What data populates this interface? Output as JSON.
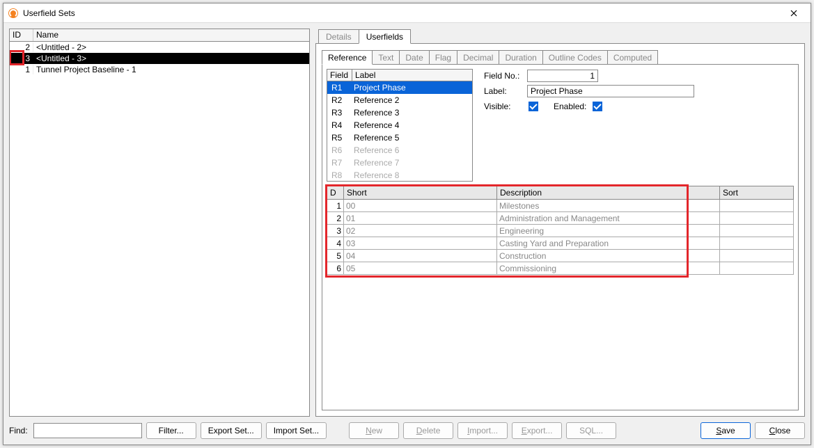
{
  "window": {
    "title": "Userfield Sets"
  },
  "sets": {
    "columns": {
      "id": "ID",
      "name": "Name"
    },
    "rows": [
      {
        "id": "2",
        "name": "<Untitled - 2>",
        "selected": false
      },
      {
        "id": "3",
        "name": "<Untitled - 3>",
        "selected": true
      },
      {
        "id": "1",
        "name": "Tunnel Project Baseline - 1",
        "selected": false
      }
    ]
  },
  "tabs": {
    "items": [
      {
        "label": "Details",
        "active": false
      },
      {
        "label": "Userfields",
        "active": true
      }
    ]
  },
  "subtabs": {
    "items": [
      {
        "label": "Reference",
        "active": true
      },
      {
        "label": "Text",
        "active": false
      },
      {
        "label": "Date",
        "active": false
      },
      {
        "label": "Flag",
        "active": false
      },
      {
        "label": "Decimal",
        "active": false
      },
      {
        "label": "Duration",
        "active": false
      },
      {
        "label": "Outline Codes",
        "active": false
      },
      {
        "label": "Computed",
        "active": false
      }
    ]
  },
  "fieldlist": {
    "columns": {
      "field": "Field",
      "label": "Label"
    },
    "rows": [
      {
        "field": "R1",
        "label": "Project Phase",
        "state": "selected"
      },
      {
        "field": "R2",
        "label": "Reference 2",
        "state": "normal"
      },
      {
        "field": "R3",
        "label": "Reference 3",
        "state": "normal"
      },
      {
        "field": "R4",
        "label": "Reference 4",
        "state": "normal"
      },
      {
        "field": "R5",
        "label": "Reference 5",
        "state": "normal"
      },
      {
        "field": "R6",
        "label": "Reference 6",
        "state": "disabled"
      },
      {
        "field": "R7",
        "label": "Reference 7",
        "state": "disabled"
      },
      {
        "field": "R8",
        "label": "Reference 8",
        "state": "disabled"
      }
    ]
  },
  "form": {
    "fieldno_label": "Field No.:",
    "fieldno_value": "1",
    "label_label": "Label:",
    "label_value": "Project Phase",
    "visible_label": "Visible:",
    "visible_checked": true,
    "enabled_label": "Enabled:",
    "enabled_checked": true
  },
  "lookup": {
    "columns": {
      "d": "D",
      "short": "Short",
      "desc": "Description",
      "sort": "Sort"
    },
    "rows": [
      {
        "d": "1",
        "short": "00",
        "desc": "Milestones",
        "sort": ""
      },
      {
        "d": "2",
        "short": "01",
        "desc": "Administration and Management",
        "sort": ""
      },
      {
        "d": "3",
        "short": "02",
        "desc": "Engineering",
        "sort": ""
      },
      {
        "d": "4",
        "short": "03",
        "desc": "Casting Yard and Preparation",
        "sort": ""
      },
      {
        "d": "5",
        "short": "04",
        "desc": "Construction",
        "sort": ""
      },
      {
        "d": "6",
        "short": "05",
        "desc": "Commissioning",
        "sort": ""
      }
    ]
  },
  "footer": {
    "find_label": "Find:",
    "find_value": "",
    "filter": "Filter...",
    "exportset": "Export Set...",
    "importset": "Import Set...",
    "new": "New",
    "delete": "Delete",
    "import": "Import...",
    "export": "Export...",
    "sql": "SQL...",
    "save": "Save",
    "close": "Close"
  }
}
